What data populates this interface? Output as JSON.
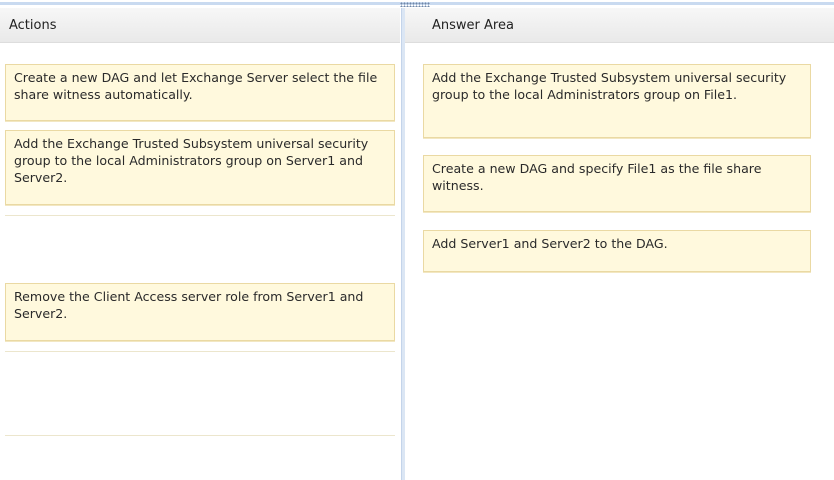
{
  "actions_panel": {
    "title": "Actions",
    "items": [
      "Create a new DAG and let Exchange Server select the file share witness automatically.",
      "Add the Exchange Trusted Subsystem universal security group to the local Administrators group on Server1 and Server2.",
      "Remove the Client Access server role from Server1 and Server2."
    ]
  },
  "answer_panel": {
    "title": "Answer Area",
    "items": [
      "Add the Exchange Trusted Subsystem universal security group to the local Administrators group on File1.",
      "Create a new DAG and specify File1 as the file share witness.",
      "Add Server1 and Server2 to the DAG."
    ]
  },
  "colors": {
    "item_background": "#fff9dd",
    "item_border": "#ead9a3",
    "splitter": "#dbe6f4"
  }
}
